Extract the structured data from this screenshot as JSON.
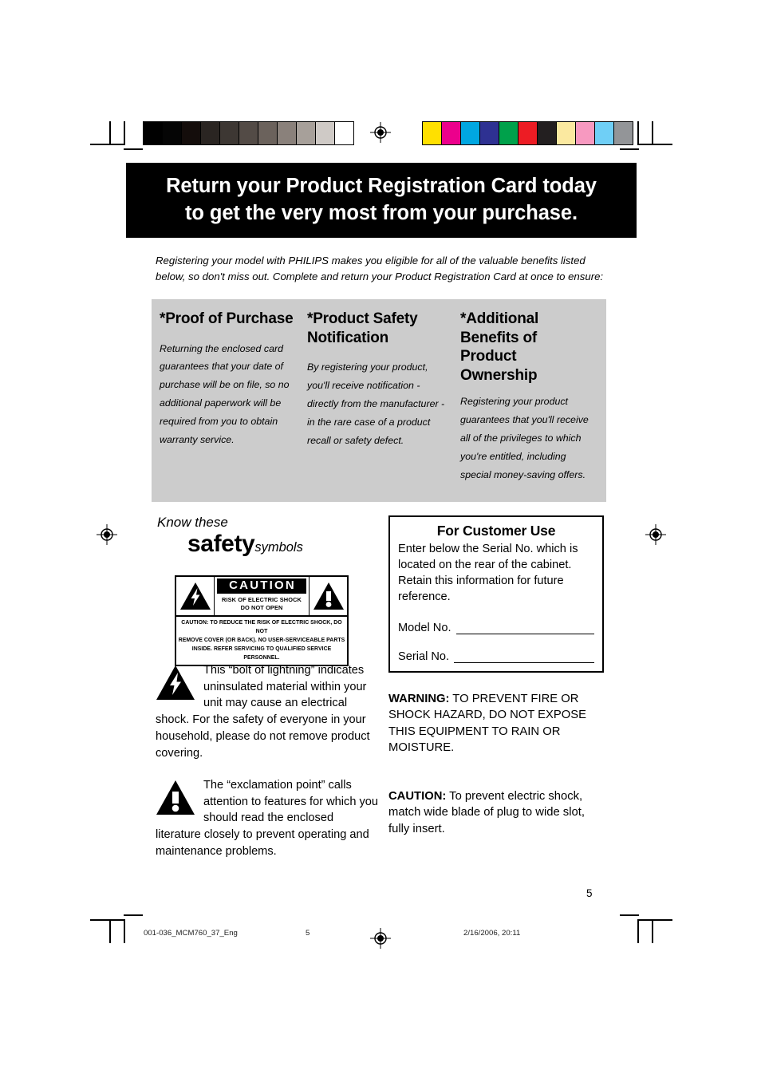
{
  "print_marks": {
    "grayscale_bar": {
      "name": "grayscale-calibration-bar",
      "patches": [
        "#000000",
        "#050505",
        "#140d0b",
        "#2a2522",
        "#3d3733",
        "#534b46",
        "#6b625c",
        "#8a817b",
        "#a7a09a",
        "#cfcac6",
        "#ffffff"
      ]
    },
    "color_bar": {
      "name": "color-calibration-bar",
      "patches": [
        "#ffe000",
        "#ec008c",
        "#00a7e1",
        "#2e3192",
        "#00a14b",
        "#ed1c24",
        "#231f20",
        "#fbe9a0",
        "#f799c0",
        "#6fcff6",
        "#939598"
      ]
    }
  },
  "header": {
    "line1": "Return your Product Registration Card today",
    "line2": "to get the very most from your purchase.",
    "background": "#000000",
    "text_color": "#ffffff"
  },
  "intro": {
    "text": "Registering your model with PHILIPS makes you eligible for all of the valuable benefits listed below, so don't miss out. Complete and return your Product Registration Card at once to ensure:"
  },
  "benefits": {
    "background": "#cccccc",
    "columns": [
      {
        "heading": "*Proof of Purchase",
        "body": "Returning the enclosed card guarantees that your date of purchase will be on file, so no additional paperwork will be required from you to obtain warranty service."
      },
      {
        "heading": "*Product Safety Notification",
        "body": "By registering your product, you'll receive notification - directly from the manufacturer - in the rare case of a product recall or safety defect."
      },
      {
        "heading": "*Additional Benefits of Product Ownership",
        "body": "Registering your product guarantees that you'll receive all of the privileges to which you're entitled, including special money-saving offers."
      }
    ]
  },
  "safety_symbols": {
    "know_these": "Know these",
    "safety": "safety",
    "symbols": "symbols"
  },
  "caution_label": {
    "caution_word": "CAUTION",
    "sub_line1": "RISK OF ELECTRIC SHOCK",
    "sub_line2": "DO NOT OPEN",
    "bottom_line1": "CAUTION: TO REDUCE THE RISK OF ELECTRIC SHOCK, DO NOT",
    "bottom_line2": "REMOVE COVER (OR BACK). NO USER-SERVICEABLE PARTS",
    "bottom_line3": "INSIDE. REFER SERVICING TO QUALIFIED SERVICE PERSONNEL."
  },
  "symbol_explanations": {
    "bolt": "This “bolt of lightning” indicates uninsulated material within your unit may cause an electrical shock. For the safety of everyone in your household, please do not remove product covering.",
    "exclamation": "The “exclamation point” calls attention to features for which you should read the enclosed literature closely to prevent operating and maintenance problems."
  },
  "customer_use": {
    "title": "For Customer Use",
    "description": "Enter below the Serial No. which is located on the rear of the cabinet. Retain this information for future reference.",
    "model_label": "Model No.",
    "serial_label": "Serial No."
  },
  "notices": {
    "warning_label": "WARNING:",
    "warning_text": " TO PREVENT FIRE OR SHOCK HAZARD, DO NOT EXPOSE THIS EQUIPMENT TO RAIN OR MOISTURE.",
    "caution_label": "CAUTION:",
    "caution_text": " To prevent electric shock, match wide blade of plug to wide slot, fully insert."
  },
  "page_number": "5",
  "footer": {
    "file_name": "001-036_MCM760_37_Eng",
    "page": "5",
    "date": "2/16/2006, 20:11"
  }
}
